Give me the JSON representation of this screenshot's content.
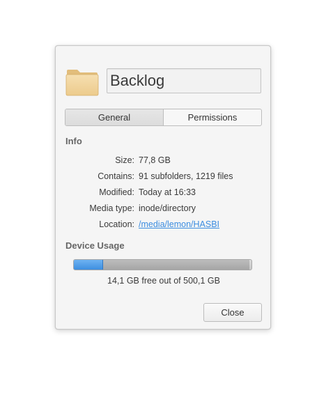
{
  "file_name": "Backlog",
  "tabs": [
    {
      "label": "General",
      "active": true
    },
    {
      "label": "Permissions",
      "active": false
    }
  ],
  "info": {
    "title": "Info",
    "rows": [
      {
        "label": "Size:",
        "value": "77,8 GB"
      },
      {
        "label": "Contains:",
        "value": "91 subfolders, 1219 files"
      },
      {
        "label": "Modified:",
        "value": "Today at 16:33"
      },
      {
        "label": "Media type:",
        "value": "inode/directory"
      },
      {
        "label": "Location:",
        "value": "/media/lemon/HASBI"
      }
    ]
  },
  "device_usage": {
    "title": "Device Usage",
    "free_fraction": 0.16,
    "used_fraction": 0.99,
    "summary": "14,1 GB free out of 500,1 GB"
  },
  "close_label": "Close",
  "colors": {
    "accent": "#3d8ee0",
    "link": "#3b8de0",
    "folder": "#f0d49c"
  },
  "icons": {
    "folder": "folder-icon"
  }
}
